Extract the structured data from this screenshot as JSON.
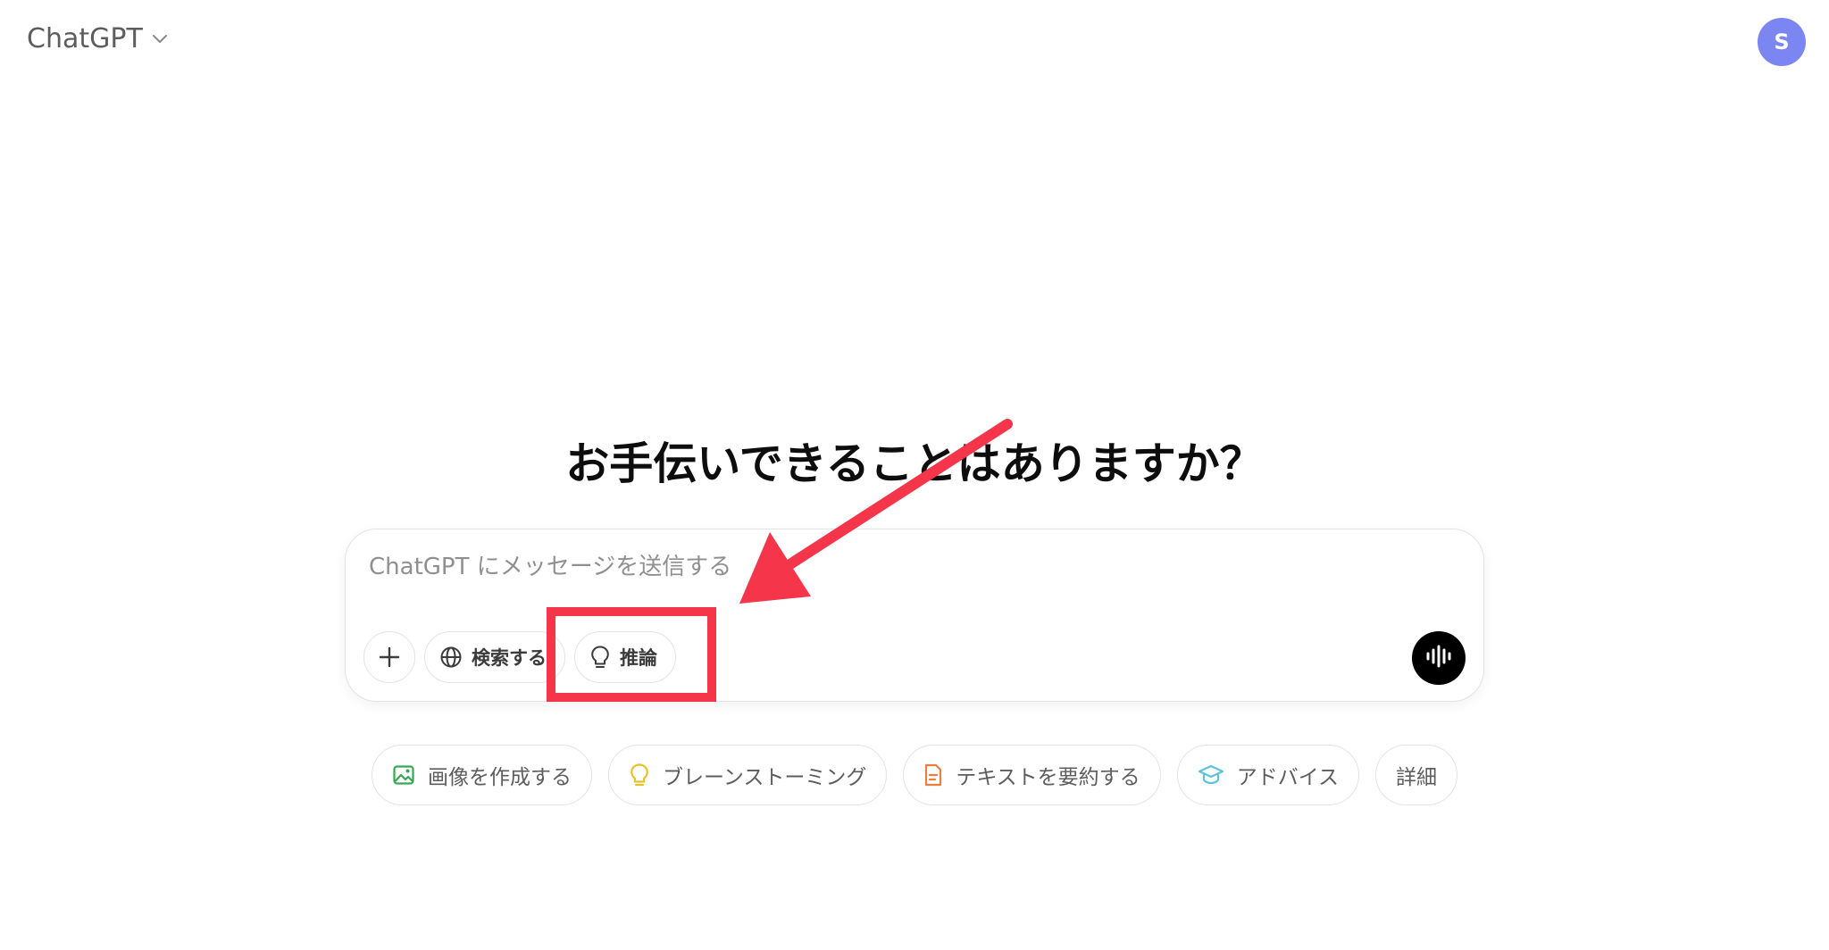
{
  "header": {
    "model_name": "ChatGPT",
    "model_chevron_icon": "chevron-down-icon",
    "avatar_initial": "S"
  },
  "hero": {
    "title": "お手伝いできることはありますか？"
  },
  "composer": {
    "placeholder": "ChatGPT にメッセージを送信する",
    "value": "",
    "add_icon": "plus-icon",
    "search_label": "検索する",
    "search_icon": "globe-icon",
    "reason_label": "推論",
    "reason_icon": "lightbulb-icon",
    "voice_icon": "voice-waveform-icon"
  },
  "suggestions": [
    {
      "label": "画像を作成する",
      "icon": "image-icon",
      "color": "#35a853"
    },
    {
      "label": "ブレーンストーミング",
      "icon": "lightbulb-icon",
      "color": "#e6c229"
    },
    {
      "label": "テキストを要約する",
      "icon": "document-icon",
      "color": "#ea7e3c"
    },
    {
      "label": "アドバイス",
      "icon": "graduation-cap-icon",
      "color": "#5cc2e0"
    },
    {
      "label": "詳細",
      "icon": "",
      "color": ""
    }
  ],
  "annotation": {
    "color": "#f5354a"
  }
}
